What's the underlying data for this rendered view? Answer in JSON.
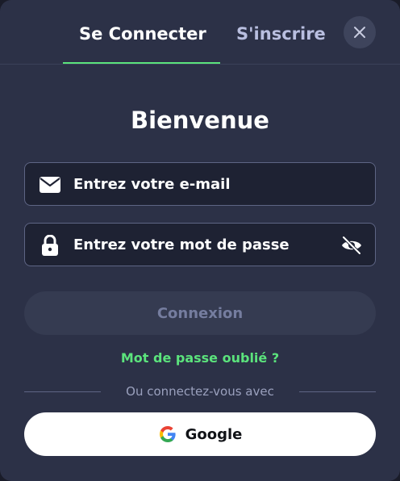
{
  "tabs": {
    "login": "Se Connecter",
    "register": "S'inscrire"
  },
  "title": "Bienvenue",
  "email": {
    "placeholder": "Entrez votre e-mail"
  },
  "password": {
    "placeholder": "Entrez votre mot de passe"
  },
  "submit_label": "Connexion",
  "forgot_label": "Mot de passe oublié ?",
  "divider_label": "Ou connectez-vous avec",
  "google_label": "Google",
  "icons": {
    "close": "close-icon",
    "email": "envelope-icon",
    "password": "lock-icon",
    "visibility": "eye-off-icon",
    "google": "google-icon"
  },
  "colors": {
    "background": "#2c3147",
    "accent": "#5be37c",
    "field_bg": "#1e2233",
    "field_border": "#5e6584",
    "disabled_button": "#353b51"
  }
}
